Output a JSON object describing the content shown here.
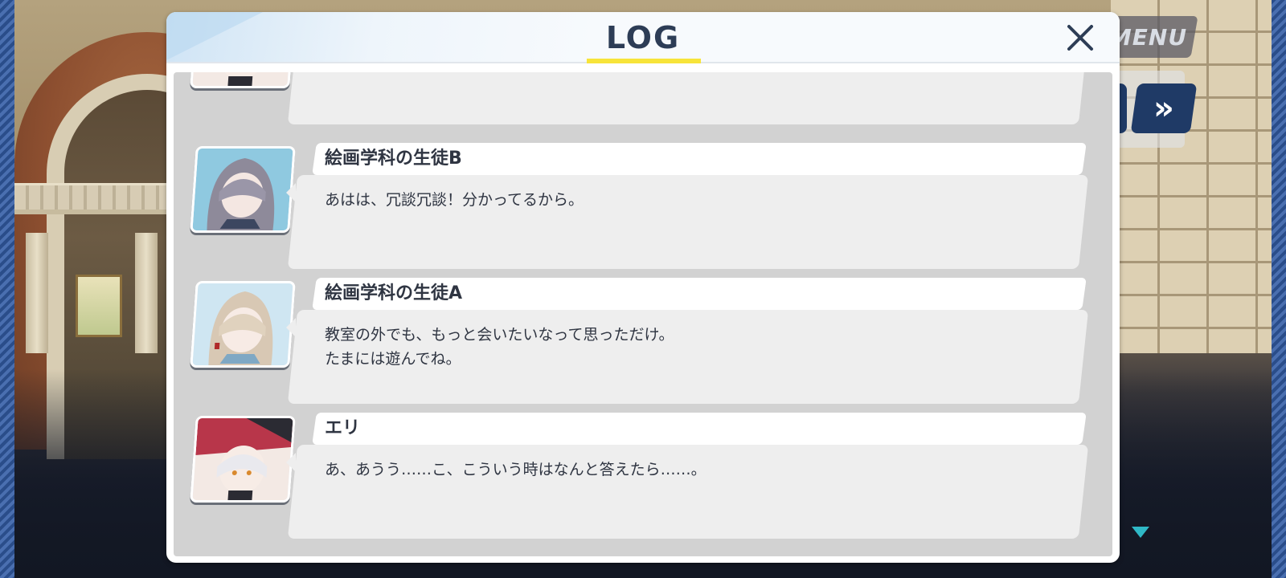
{
  "game_ui": {
    "menu_label": "MENU",
    "fast_forward_label": "»",
    "fast_forward_icon": "double-chevron-right-icon",
    "scroll_down_icon": "triangle-down-icon"
  },
  "log": {
    "title": "LOG",
    "close_icon": "close-x-icon",
    "accent_color": "#f7e43a",
    "entries": [
      {
        "speaker": "",
        "lines": [
          ""
        ],
        "portrait_icon": "portrait-eri-icon"
      },
      {
        "speaker": "絵画学科の生徒B",
        "lines": [
          "あはは、冗談冗談！分かってるから。"
        ],
        "portrait_icon": "portrait-student-b-icon"
      },
      {
        "speaker": "絵画学科の生徒A",
        "lines": [
          "教室の外でも、もっと会いたいなって思っただけ。",
          "たまには遊んでね。"
        ],
        "portrait_icon": "portrait-student-a-icon"
      },
      {
        "speaker": "エリ",
        "lines": [
          "あ、あうう……こ、こういう時はなんと答えたら……。"
        ],
        "portrait_icon": "portrait-eri-icon"
      }
    ]
  }
}
